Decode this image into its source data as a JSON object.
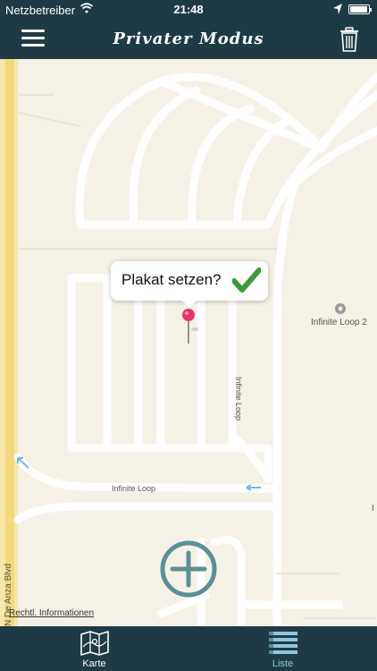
{
  "status_bar": {
    "carrier": "Netzbetreiber",
    "time": "21:48",
    "battery_level": 0.85
  },
  "nav": {
    "title": "Privater Modus",
    "menu_icon": "hamburger-menu-icon",
    "trash_icon": "trash-icon"
  },
  "map": {
    "labels": {
      "infinite_loop_2": "Infinite Loop 2",
      "infinite_loop_vertical": "Infinite Loop",
      "infinite_loop_horizontal": "Infinite Loop",
      "de_anza": "N De Anza Blvd",
      "edge_letter": "I"
    },
    "legal": "Rechtl. Informationen",
    "callout": {
      "text": "Plakat setzen?",
      "confirm_icon": "checkmark-icon"
    },
    "pin_icon": "map-pin-icon",
    "add_icon": "plus-circle-icon"
  },
  "tabs": [
    {
      "label": "Karte",
      "icon": "map-icon",
      "active": true
    },
    {
      "label": "Liste",
      "icon": "list-icon",
      "active": false
    }
  ],
  "colors": {
    "bar_bg": "#1e3b45",
    "map_bg": "#f6f1e6",
    "road": "#ffffff",
    "accent": "#5a8f97",
    "check": "#3d9a3d",
    "pin": "#e8336b",
    "list_tab": "#8ec6dd"
  }
}
